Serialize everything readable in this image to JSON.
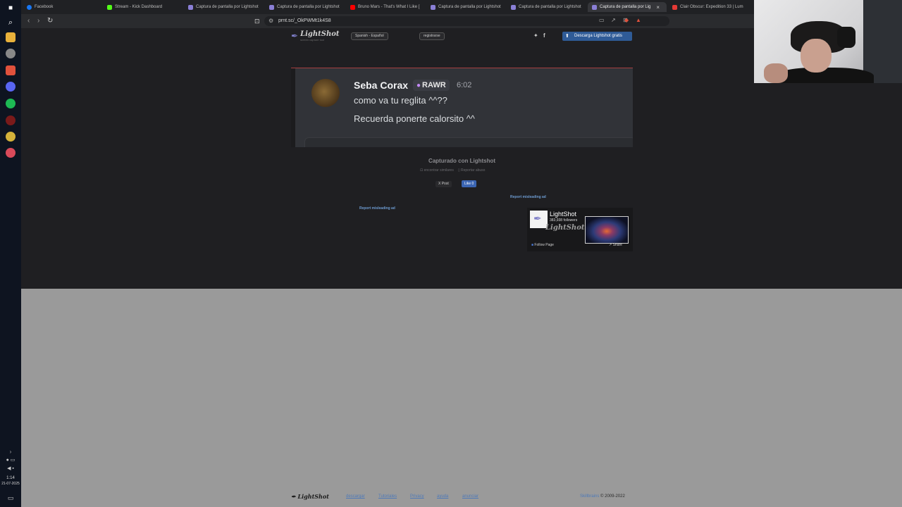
{
  "browser": {
    "tabs": [
      {
        "title": "Facebook",
        "color": "#1877f2"
      },
      {
        "title": "Stream - Kick Dashboard",
        "color": "#53fc18"
      },
      {
        "title": "Captura de pantalla por Lightshot",
        "color": "#8a7fd6"
      },
      {
        "title": "Captura de pantalla por Lightshot",
        "color": "#8a7fd6"
      },
      {
        "title": "Bruno Mars - That's What I Like [",
        "color": "#ff0000"
      },
      {
        "title": "Captura de pantalla por Lightshot",
        "color": "#8a7fd6"
      },
      {
        "title": "Captura de pantalla por Lightshot",
        "color": "#8a7fd6"
      },
      {
        "title": "Captura de pantalla por Lig",
        "color": "#8a7fd6"
      },
      {
        "title": "Clair Obscur: Expedition 33 | Lum",
        "color": "#e53935"
      }
    ],
    "url": "prnt.sc/_OkPWMt1k4S8"
  },
  "lightshot": {
    "logo_name": "LightShot",
    "logo_tagline": "screen capture tool",
    "language_button": "Spanish - Español",
    "register_button": "registrarse",
    "download_button": "Descarga Lightshot gratis",
    "captured_label": "Capturado con Lightshot",
    "similar_link": "encontrar similares",
    "report_abuse_link": "Reportar abuso",
    "x_post_label": "X Post",
    "like_label": "Like 0",
    "report_ad_label": "Report misleading ad"
  },
  "screenshot": {
    "username": "Seba Corax",
    "badge": "RAWR",
    "time": "6:02",
    "messages": [
      "como va tu reglita ^^??",
      "Recuerda ponerte calorsito ^^"
    ]
  },
  "fb_widget": {
    "name": "LightShot",
    "followers": "383,938 followers",
    "watermark": "LightShot",
    "follow_label": "Follow Page",
    "share_label": "Share"
  },
  "footer": {
    "logo": "LightShot",
    "links": [
      "descargar",
      "Tutoriales",
      "Privacy",
      "ayuda",
      "anunciar"
    ],
    "skillbrains": "Skillbrains",
    "copyright": "© 2009-2022"
  },
  "taskbar": {
    "time": "1:14",
    "date": "21-07-2025"
  },
  "colors": {
    "accent": "#2f5b97",
    "link": "#6d9bd1",
    "page_bg": "#1f1f22",
    "gray_bg": "#9a9a9a"
  }
}
